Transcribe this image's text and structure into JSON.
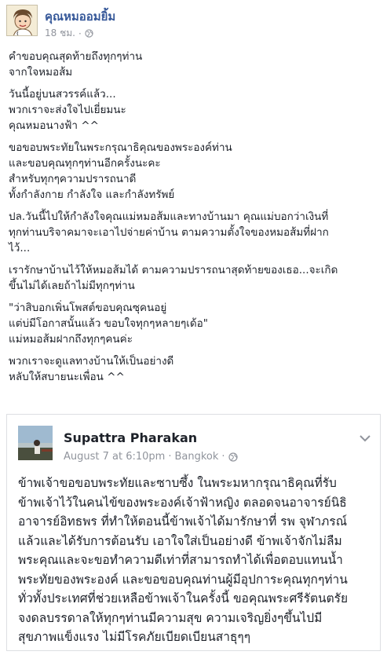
{
  "post": {
    "author": "คุณหมออมยิ้ม",
    "time": "18 ชม.",
    "separator": "·",
    "privacy_icon": "globe-icon",
    "paragraphs": [
      {
        "lines": [
          "คำขอบคุณสุดท้ายถึงทุกๆท่าน",
          "จากใจหมอส้ม"
        ]
      },
      {
        "lines": [
          "วันนี้อยู่บนสวรรค์แล้ว...",
          "พวกเราจะส่งใจไปเยี่ยมนะ",
          "คุณหมอนางฟ้า ^^"
        ]
      },
      {
        "lines": [
          "ขอขอบพระทัยในพระกรุณาธิคุณของพระองค์ท่าน",
          "และขอบคุณทุกๆท่านอีกครั้งนะคะ",
          "สำหรับทุกๆความปรารถนาดี",
          "ทั้งกำลังกาย กำลังใจ และกำลังทรัพย์"
        ]
      },
      {
        "lines": [
          "ปล.วันนี้ไปให้กำลังใจคุณแม่หมอส้มและทางบ้านมา คุณแม่บอกว่าเงินที่",
          "ทุกท่านบริจาคมาจะเอาไปจ่ายค่าบ้าน ตามความตั้งใจของหมอส้มที่ฝาก",
          "ไว้..."
        ]
      },
      {
        "lines": [
          "เรารักษาบ้านไว้ให้หมอส้มได้ ตามความปรารถนาสุดท้ายของเธอ...จะเกิด",
          "ขึ้นไม่ได้เลยถ้าไม่มีทุกๆท่าน"
        ]
      },
      {
        "lines": [
          "\"ว่าสิบอกเพิ่นโพสต์ขอบคุณซุคนอยู่",
          "แต่บ่มีโอกาสนั้นแล้ว ขอบใจทุกๆหลายๆเด้อ\"",
          "แม่หมอส้มฝากถึงทุกๆคนค่ะ"
        ]
      },
      {
        "lines": [
          "พวกเราจะดูแลทางบ้านให้เป็นอย่างดี",
          "หลับให้สบายนะเพื่อน ^^"
        ]
      }
    ]
  },
  "shared_post": {
    "author": "Supattra Pharakan",
    "date": "August 7 at 6:10pm",
    "separator": "·",
    "location": "Bangkok",
    "separator2": "·",
    "privacy_icon": "globe-icon",
    "lines": [
      "ข้าพเจ้าขอขอบพระทัยและซาบซึ้ง ในพระมหากรุณาธิคุณที่รับ",
      "ข้าพเจ้าไว้ในคนไข้ของพระองค์เจ้าฟ้าหญิง ตลอดจนอาจารย์นิธิ",
      "อาจารย์อิทธพร ที่ทำให้ตอนนี้ข้าพเจ้าได้มารักษาที่ รพ จุฬาภรณ์",
      "แล้วและได้รับการต้อนรับ เอาใจใส่เป็นอย่างดี ข้าพเจ้าจักไม่ลืม",
      "พระคุณและจะขอทำความดีเท่าที่สามารถทำได้เพื่อตอบแทนน้ำ",
      "พระทัยของพระองค์ และขอขอบคุณท่านผู้มีอุปการะคุณทุกๆท่าน",
      "ทั่วทั้งประเทศที่ช่วยเหลือข้าพเจ้าในครั้งนี้ ขอคุณพระศรีรัตนตรัย",
      "จงดลบรรดาลให้ทุกๆท่านมีความสุข ความเจริญยิ่งๆขึ้นไปมี",
      "สุขภาพแข็งแรง ไม่มีโรคภัยเบียดเบียนสาธุๆๆ"
    ]
  },
  "colors": {
    "link_blue": "#365899",
    "meta_gray": "#90949c",
    "text": "#1d2129",
    "border": "#dddfe2"
  }
}
